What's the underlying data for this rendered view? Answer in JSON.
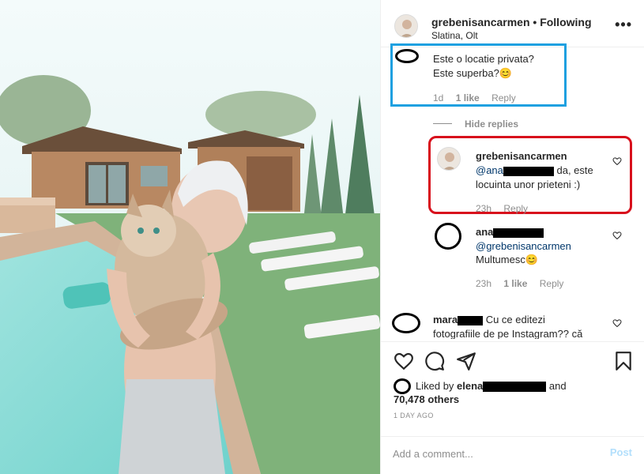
{
  "post": {
    "username": "grebenisancarmen",
    "separator": "•",
    "follow_status": "Following",
    "location": "Slatina, Olt",
    "more": "•••"
  },
  "comments": [
    {
      "text_line1": "Este o locatie privata?",
      "text_line2": "Este superba?😊",
      "time": "1d",
      "likes": "1 like",
      "reply": "Reply"
    }
  ],
  "hide_replies": "Hide replies",
  "replies": [
    {
      "username": "grebenisancarmen",
      "mention": "@ana",
      "text_after": " da, este",
      "text_line2": "locuinta unor prieteni :)",
      "time": "23h",
      "reply": "Reply"
    },
    {
      "username": "ana",
      "mention": "@grebenisancarmen",
      "text_line2": "Multumesc😊",
      "time": "23h",
      "likes": "1 like",
      "reply": "Reply"
    }
  ],
  "comment3": {
    "username": "mara",
    "text_line1": "Cu ce editezi",
    "text_line2": "fotografiile de pe Instagram?? că"
  },
  "likes": {
    "prefix": "Liked by",
    "name": "elena",
    "and": "and",
    "count": "70,478 others"
  },
  "date": "1 DAY AGO",
  "add_comment": {
    "placeholder": "Add a comment...",
    "post_label": "Post"
  },
  "colors": {
    "blue_highlight": "#1ea0e0",
    "red_highlight": "#d8101c",
    "link": "#00376b"
  }
}
